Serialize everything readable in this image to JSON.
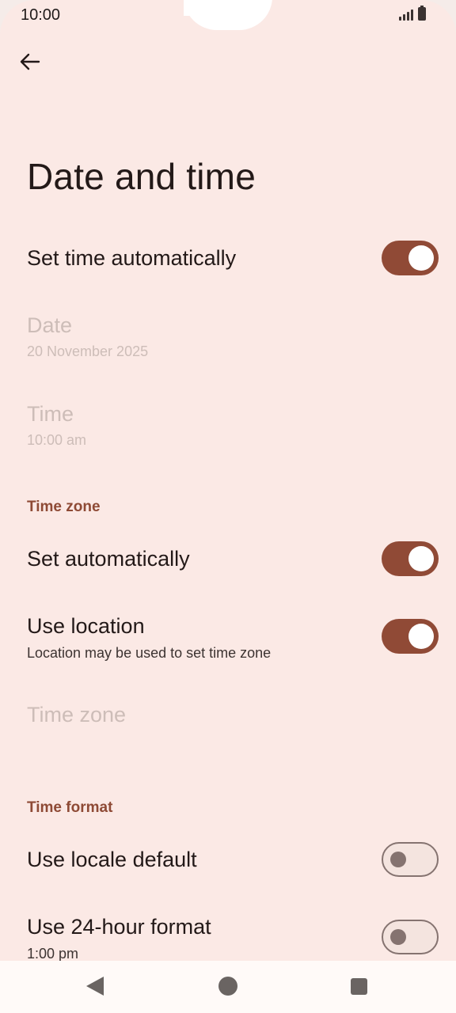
{
  "status_bar": {
    "time": "10:00"
  },
  "header": {
    "title": "Date and time"
  },
  "settings": {
    "set_time_automatically": {
      "label": "Set time automatically",
      "enabled": true
    },
    "date": {
      "label": "Date",
      "value": "20 November 2025"
    },
    "time": {
      "label": "Time",
      "value": "10:00 am"
    },
    "time_zone_section": {
      "header": "Time zone"
    },
    "set_automatically": {
      "label": "Set automatically",
      "enabled": true
    },
    "use_location": {
      "label": "Use location",
      "summary": "Location may be used to set time zone",
      "enabled": true
    },
    "time_zone": {
      "label": "Time zone"
    },
    "time_format_section": {
      "header": "Time format"
    },
    "use_locale_default": {
      "label": "Use locale default",
      "enabled": false
    },
    "use_24_hour": {
      "label": "Use 24-hour format",
      "summary": "1:00 pm",
      "enabled": false
    }
  },
  "icons": {
    "back": "arrow-left-icon",
    "signal": "signal-icon",
    "battery": "battery-icon",
    "nav_back": "triangle-back-icon",
    "nav_home": "circle-home-icon",
    "nav_recent": "square-recent-icon"
  },
  "colors": {
    "background": "#fbe9e5",
    "accent": "#904a36",
    "section_header": "#8e4a35",
    "disabled_text": "#cdbdb8"
  }
}
